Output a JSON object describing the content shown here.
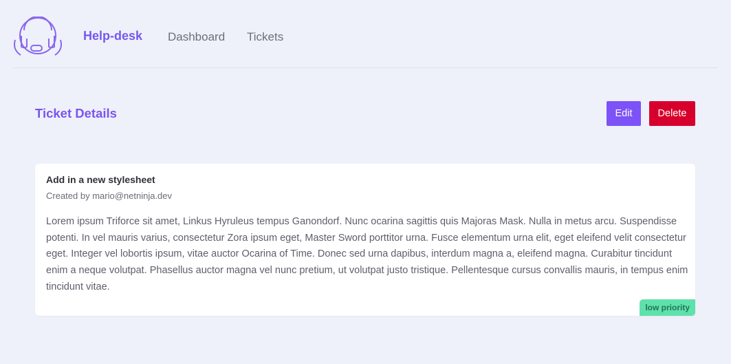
{
  "nav": {
    "logo_icon": "headset-support-icon",
    "brand": "Help-desk",
    "links": [
      "Dashboard",
      "Tickets"
    ],
    "accent_color": "#7857ef"
  },
  "page": {
    "title": "Ticket Details"
  },
  "actions": {
    "edit_label": "Edit",
    "delete_label": "Delete",
    "edit_color": "#7d52f7",
    "delete_color": "#d7002d"
  },
  "ticket": {
    "title": "Add in a new stylesheet",
    "created_by": "Created by mario@netninja.dev",
    "body": "Lorem ipsum Triforce sit amet, Linkus Hyruleus tempus Ganondorf. Nunc ocarina sagittis quis Majoras Mask. Nulla in metus arcu. Suspendisse potenti. In vel mauris varius, consectetur Zora ipsum eget, Master Sword porttitor urna. Fusce elementum urna elit, eget eleifend velit consectetur eget. Integer vel lobortis ipsum, vitae auctor Ocarina of Time. Donec sed urna dapibus, interdum magna a, eleifend magna. Curabitur tincidunt enim a neque volutpat. Phasellus auctor magna vel nunc pretium, ut volutpat justo tristique. Pellentesque cursus convallis mauris, in tempus enim tincidunt vitae.",
    "priority": "low priority",
    "priority_color": "#5fe1ab"
  }
}
